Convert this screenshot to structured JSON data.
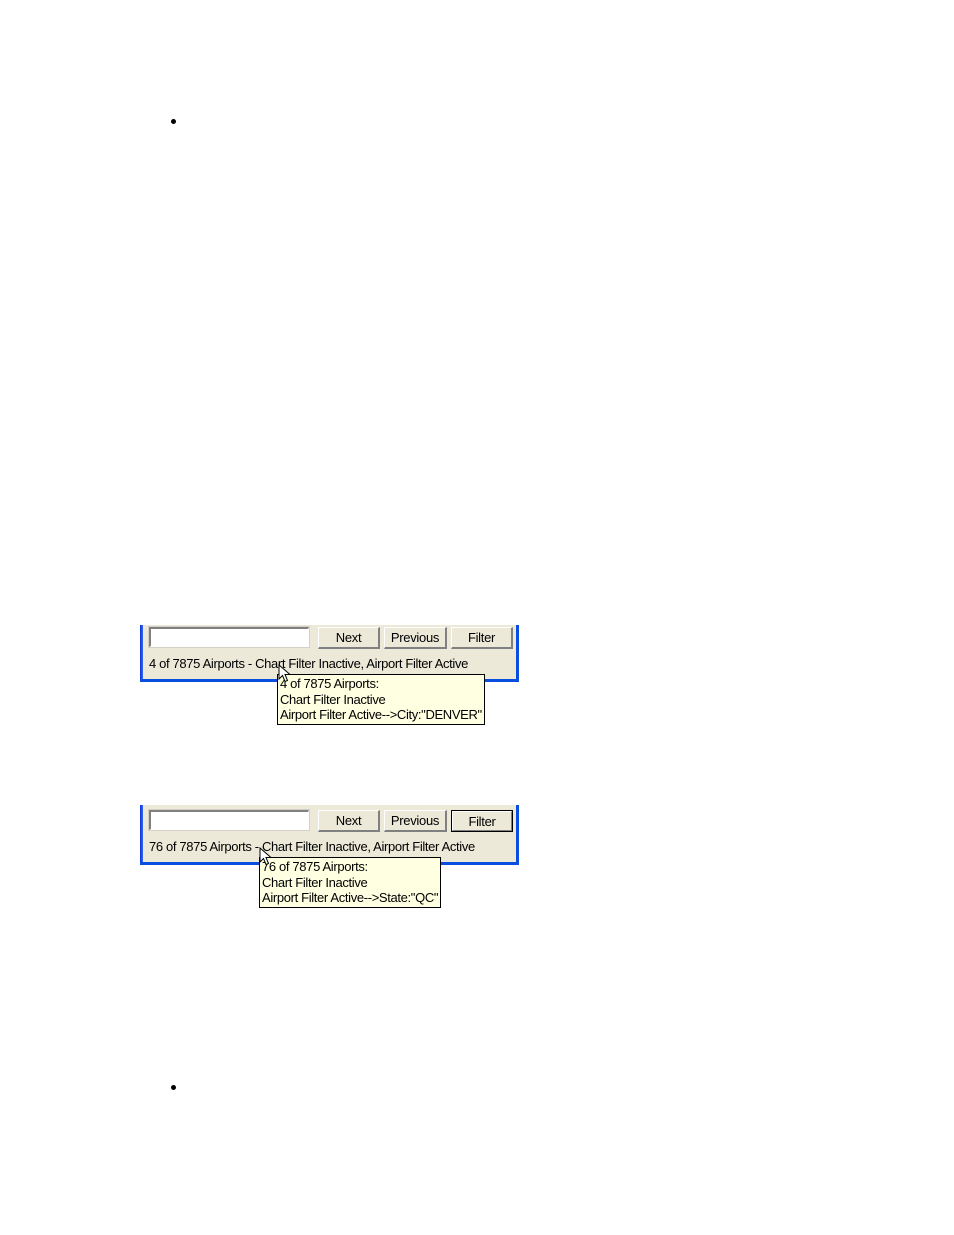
{
  "bullets": [
    {
      "symbol": "•"
    },
    {
      "symbol": "•"
    }
  ],
  "screenshots": [
    {
      "search_value": "",
      "buttons": {
        "next": "Next",
        "previous": "Previous",
        "filter": "Filter"
      },
      "status": "4 of 7875 Airports - Chart Filter Inactive, Airport Filter Active",
      "tooltip": {
        "line1": "4 of 7875 Airports:",
        "line2": "Chart Filter Inactive",
        "line3": "Airport Filter Active-->City:\"DENVER\""
      },
      "cursor_icon": "arrow-pointer"
    },
    {
      "search_value": "",
      "buttons": {
        "next": "Next",
        "previous": "Previous",
        "filter": "Filter"
      },
      "status": "76 of 7875 Airports - Chart Filter Inactive, Airport Filter Active",
      "tooltip": {
        "line1": "76 of 7875 Airports:",
        "line2": "Chart Filter Inactive",
        "line3": "Airport Filter Active-->State:\"QC\""
      },
      "cursor_icon": "arrow-pointer"
    }
  ],
  "colors": {
    "window_border": "#0a4ee0",
    "panel_bg": "#ece9d8",
    "tooltip_bg": "#ffffe1"
  }
}
